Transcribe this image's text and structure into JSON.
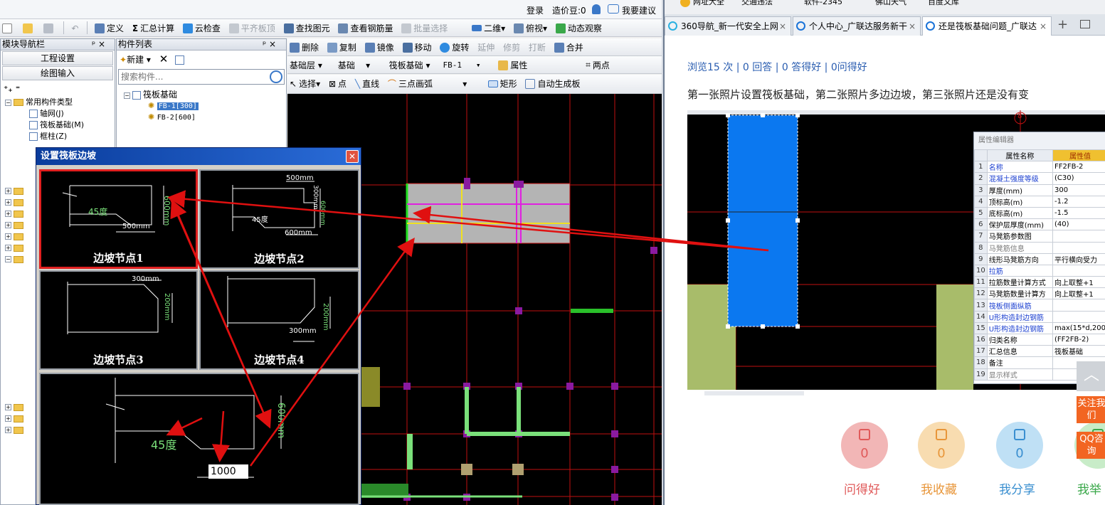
{
  "left_app": {
    "topbar": {
      "login": "登录",
      "price_bean": "造价豆:0",
      "suggest": "我要建议"
    },
    "toolbar1": {
      "items": [
        "定义",
        "汇总计算",
        "云检查",
        "平齐板顶",
        "查找图元",
        "查看钢筋量",
        "批量选择",
        "二维",
        "俯视",
        "动态观察"
      ]
    },
    "module_nav": {
      "title": "模块导航栏",
      "btn_project": "工程设置",
      "btn_draw": "绘图输入",
      "tree_root": "常用构件类型",
      "tree_items": [
        "轴网(J)",
        "筏板基础(M)",
        "框柱(Z)"
      ]
    },
    "component_list": {
      "title": "构件列表",
      "new_btn": "新建",
      "search_placeholder": "搜索构件...",
      "root": "筏板基础",
      "items": [
        "FB-1[300]",
        "FB-2[600]"
      ]
    },
    "edit_toolbar": {
      "items": [
        "删除",
        "复制",
        "镜像",
        "移动",
        "旋转",
        "延伸",
        "修剪",
        "打断",
        "合并"
      ]
    },
    "layer_toolbar": {
      "layer": "基础层",
      "category": "基础",
      "type": "筏板基础",
      "component": "FB-1",
      "attr": "属性",
      "two_point": "两点"
    },
    "draw_toolbar": {
      "items": [
        "选择",
        "点",
        "直线",
        "三点画弧",
        "矩形",
        "自动生成板"
      ]
    }
  },
  "dialog": {
    "title": "设置筏板边坡",
    "tiles": [
      {
        "caption": "边坡节点1",
        "dims": [
          "600mm",
          "45度",
          "500mm"
        ]
      },
      {
        "caption": "边坡节点2",
        "dims": [
          "500mm",
          "300mm",
          "600mm",
          "45度",
          "600mm"
        ]
      },
      {
        "caption": "边坡节点3",
        "dims": [
          "300mm",
          "200mm"
        ]
      },
      {
        "caption": "边坡节点4",
        "dims": [
          "300mm",
          "200mm"
        ]
      }
    ],
    "detail": {
      "angle": "45度",
      "height": "600mm",
      "width_value": "1000"
    }
  },
  "browser": {
    "bookmarks": [
      "网址大全",
      "交通违法",
      "软件-2345",
      "佛山天气",
      "百度文库"
    ],
    "tabs": [
      {
        "title": "360导航_新一代安全上网",
        "active": false
      },
      {
        "title": "个人中心_广联达服务新干",
        "active": false
      },
      {
        "title": "还是筏板基础问题_广联达",
        "active": true
      }
    ],
    "stats": "浏览15 次 | 0 回答 | 0 答得好 | 0问得好",
    "question": "第一张照片设置筏板基础，第二张照片多边边坡，第三张照片还是没有变",
    "property_editor": {
      "title": "属性编辑器",
      "header_name": "属性名称",
      "header_value": "属性值",
      "rows": [
        {
          "num": "1",
          "name": "名称",
          "value": "FF2FB-2",
          "style": "blue"
        },
        {
          "num": "2",
          "name": "混凝土强度等级",
          "value": "(C30)",
          "style": "blue"
        },
        {
          "num": "3",
          "name": "厚度(mm)",
          "value": "300",
          "style": "blk"
        },
        {
          "num": "4",
          "name": "顶标高(m)",
          "value": "-1.2",
          "style": "blk"
        },
        {
          "num": "5",
          "name": "底标高(m)",
          "value": "-1.5",
          "style": "blk"
        },
        {
          "num": "6",
          "name": "保护层厚度(mm)",
          "value": "(40)",
          "style": "blk"
        },
        {
          "num": "7",
          "name": "马凳筋参数图",
          "value": "",
          "style": "blk"
        },
        {
          "num": "8",
          "name": "马凳筋信息",
          "value": "",
          "style": "gray"
        },
        {
          "num": "9",
          "name": "线形马凳筋方向",
          "value": "平行横向受力",
          "style": "blk"
        },
        {
          "num": "10",
          "name": "拉筋",
          "value": "",
          "style": "blue"
        },
        {
          "num": "11",
          "name": "拉筋数量计算方式",
          "value": "向上取整+1",
          "style": "blk"
        },
        {
          "num": "12",
          "name": "马凳筋数量计算方",
          "value": "向上取整+1",
          "style": "blk"
        },
        {
          "num": "13",
          "name": "筏板侧面纵筋",
          "value": "",
          "style": "blue"
        },
        {
          "num": "14",
          "name": "U形构造封边钢筋",
          "value": "",
          "style": "blue"
        },
        {
          "num": "15",
          "name": "U形构造封边钢筋",
          "value": "max(15*d,200",
          "style": "blue"
        },
        {
          "num": "16",
          "name": "归类名称",
          "value": "(FF2FB-2)",
          "style": "blk"
        },
        {
          "num": "17",
          "name": "汇总信息",
          "value": "筏板基础",
          "style": "blk"
        },
        {
          "num": "18",
          "name": "备注",
          "value": "",
          "style": "blk"
        },
        {
          "num": "19",
          "name": "显示样式",
          "value": "",
          "style": "gray"
        }
      ]
    },
    "actions": [
      {
        "label": "问得好",
        "count": "0",
        "color": "#f2b6b6",
        "text_color": "#e05a5a"
      },
      {
        "label": "我收藏",
        "count": "0",
        "color": "#f8dcb0",
        "text_color": "#e8963a"
      },
      {
        "label": "我分享",
        "count": "0",
        "color": "#bfe0f5",
        "text_color": "#3a8fd0"
      },
      {
        "label": "我举",
        "count": "",
        "color": "#c8ecc8",
        "text_color": "#3aa84a"
      }
    ],
    "float_follow": "关注我们",
    "float_qq": "QQ咨询"
  }
}
